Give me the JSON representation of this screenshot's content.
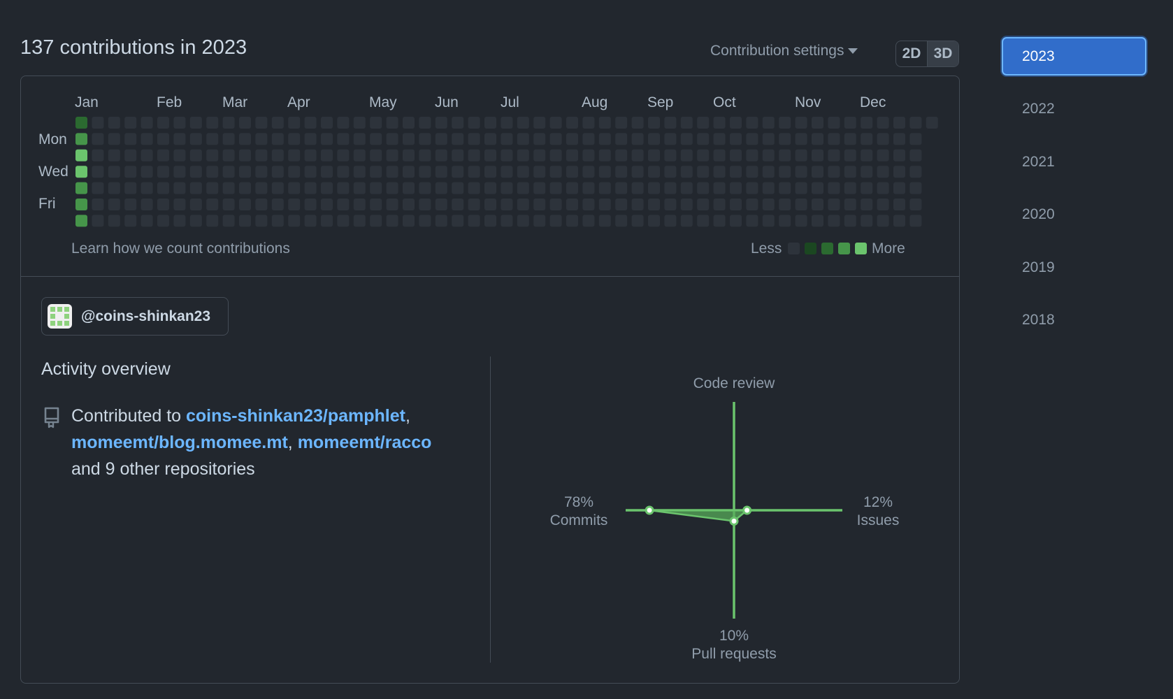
{
  "header": {
    "title": "137 contributions in 2023",
    "settings_label": "Contribution settings",
    "view_2d": "2D",
    "view_3d": "3D",
    "active_view": "3D"
  },
  "calendar": {
    "months": [
      "Jan",
      "Feb",
      "Mar",
      "Apr",
      "May",
      "Jun",
      "Jul",
      "Aug",
      "Sep",
      "Oct",
      "Nov",
      "Dec"
    ],
    "day_labels": [
      "Mon",
      "Wed",
      "Fri"
    ],
    "weeks": 53,
    "active_week": 0,
    "active_levels": [
      2,
      3,
      4,
      4,
      3,
      3,
      3
    ],
    "last_week_days": 1,
    "learn_link": "Learn how we count contributions",
    "legend_less": "Less",
    "legend_more": "More",
    "colors": {
      "empty": "#2d333b",
      "level1": "#1b4721",
      "level2": "#2b6a30",
      "level3": "#46954a",
      "level4": "#6bc46d"
    }
  },
  "user": {
    "username": "@coins-shinkan23"
  },
  "activity": {
    "title": "Activity overview",
    "contributed_prefix": "Contributed to",
    "repos": [
      "coins-shinkan23/pamphlet",
      "momeemt/blog.momee.mt",
      "momeemt/racco"
    ],
    "suffix": "and 9 other repositories",
    "radar": {
      "code_review_label": "Code review",
      "commits_pct": "78%",
      "commits_label": "Commits",
      "issues_pct": "12%",
      "issues_label": "Issues",
      "pr_pct": "10%",
      "pr_label": "Pull requests",
      "values": {
        "code_review": 0,
        "commits": 78,
        "issues": 12,
        "pull_requests": 10
      },
      "color": "#57ab5a"
    }
  },
  "years": [
    "2023",
    "2022",
    "2021",
    "2020",
    "2019",
    "2018"
  ],
  "selected_year": "2023",
  "accent": "#316dca"
}
